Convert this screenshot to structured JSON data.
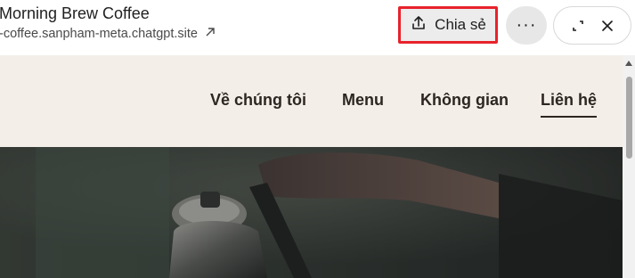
{
  "header": {
    "title": "Morning Brew Coffee",
    "url": "-coffee.sanpham-meta.chatgpt.site",
    "share_label": "Chia sẻ",
    "more_label": "···"
  },
  "nav": {
    "items": [
      {
        "label": "Về chúng tôi"
      },
      {
        "label": "Menu"
      },
      {
        "label": "Không gian"
      },
      {
        "label": "Liên hệ"
      }
    ],
    "active_label": "Liên hệ"
  },
  "colors": {
    "highlight_border": "#e8222c",
    "nav_background": "#f3efe8",
    "nav_text": "#2d2622"
  }
}
